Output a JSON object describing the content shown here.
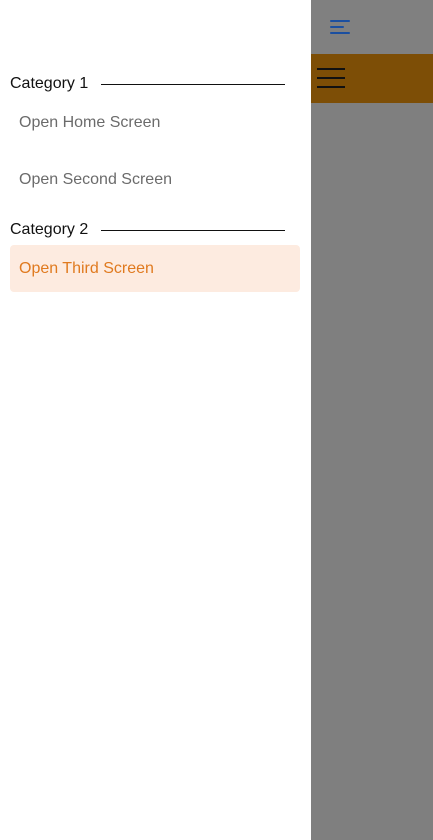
{
  "header": {
    "icon": "hamburger-menu-icon",
    "accent_color": "#1b4fa0"
  },
  "toolbar": {
    "icon": "hamburger-menu-icon",
    "background_color": "#7d4e06"
  },
  "drawer": {
    "categories": [
      {
        "label": "Category 1",
        "items": [
          {
            "label": "Open Home Screen",
            "active": false
          },
          {
            "label": "Open Second Screen",
            "active": false
          }
        ]
      },
      {
        "label": "Category 2",
        "items": [
          {
            "label": "Open Third Screen",
            "active": true
          }
        ]
      }
    ],
    "active_color": "#e07a1f",
    "active_background": "#fdebe0"
  }
}
